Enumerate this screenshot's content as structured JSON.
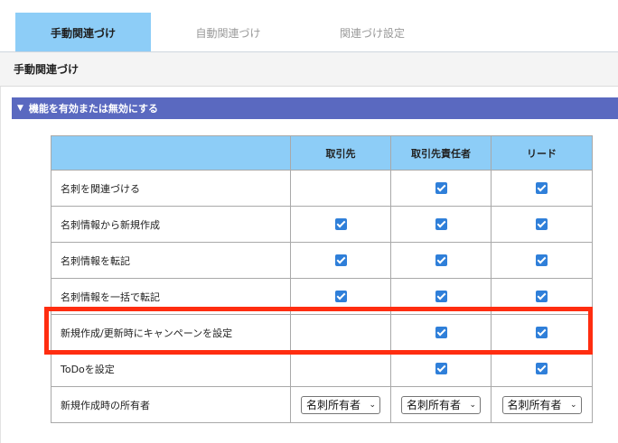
{
  "tabs": [
    {
      "label": "手動関連づけ",
      "active": true
    },
    {
      "label": "自動関連づけ",
      "active": false
    },
    {
      "label": "関連づけ設定",
      "active": false
    }
  ],
  "section_title": "手動関連づけ",
  "collapsible": {
    "label": "機能を有効または無効にする"
  },
  "table": {
    "headers": [
      "",
      "取引先",
      "取引先責任者",
      "リード"
    ],
    "rows": [
      {
        "label": "名刺を関連づける",
        "cells": [
          false,
          true,
          true
        ]
      },
      {
        "label": "名刺情報から新規作成",
        "cells": [
          true,
          true,
          true
        ]
      },
      {
        "label": "名刺情報を転記",
        "cells": [
          true,
          true,
          true
        ]
      },
      {
        "label": "名刺情報を一括で転記",
        "cells": [
          true,
          true,
          true
        ]
      },
      {
        "label": "新規作成/更新時にキャンペーンを設定",
        "cells": [
          false,
          true,
          true
        ]
      },
      {
        "label": "ToDoを設定",
        "cells": [
          false,
          true,
          true
        ]
      },
      {
        "label": "新規作成時の所有者",
        "cells": [
          "名刺所有者",
          "名刺所有者",
          "名刺所有者"
        ]
      }
    ]
  },
  "colors": {
    "tab_active": "#8dcdf7",
    "header_bar": "#5a69c0",
    "table_header": "#8dcdf7",
    "highlight": "#ff2d10",
    "checkbox": "#2f7fd9"
  }
}
